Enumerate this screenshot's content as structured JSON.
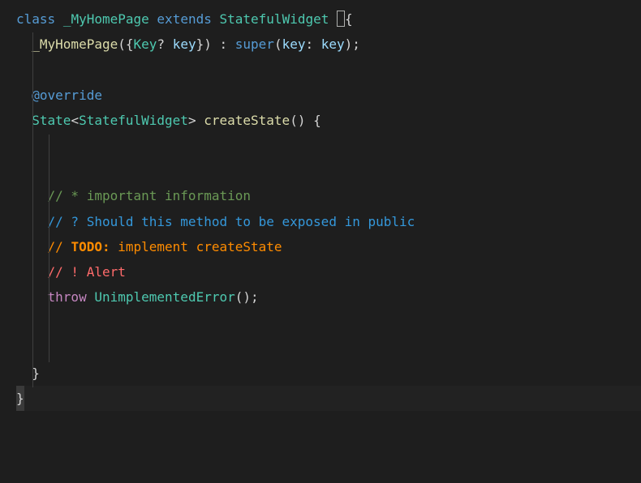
{
  "code": {
    "line1": {
      "kw_class": "class",
      "class_name": "_MyHomePage",
      "kw_extends": "extends",
      "parent_class": "StatefulWidget",
      "brace": "{"
    },
    "line2": {
      "constructor": "_MyHomePage",
      "open_paren": "({",
      "key_type": "Key",
      "nullable": "?",
      "key_param": "key",
      "close_named": "})",
      "colon": " : ",
      "super_kw": "super",
      "super_open": "(",
      "named_label": "key",
      "named_colon": ": ",
      "named_val": "key",
      "super_close": ");"
    },
    "line4": {
      "annotation": "@override"
    },
    "line5": {
      "return_type": "State",
      "generic_open": "<",
      "generic_type": "StatefulWidget",
      "generic_close": ">",
      "method_name": "createState",
      "parens": "()",
      "brace": " {"
    },
    "line8": {
      "comment": "// * important information"
    },
    "line9": {
      "comment": "// ? Should this method to be exposed in public"
    },
    "line10": {
      "prefix": "// ",
      "todo": "TODO:",
      "rest": " implement createState"
    },
    "line11": {
      "comment": "// ! Alert"
    },
    "line12": {
      "throw_kw": "throw",
      "error_type": "UnimplementedError",
      "parens": "();"
    },
    "line15": {
      "brace": "}"
    },
    "line16": {
      "brace": "}"
    }
  }
}
